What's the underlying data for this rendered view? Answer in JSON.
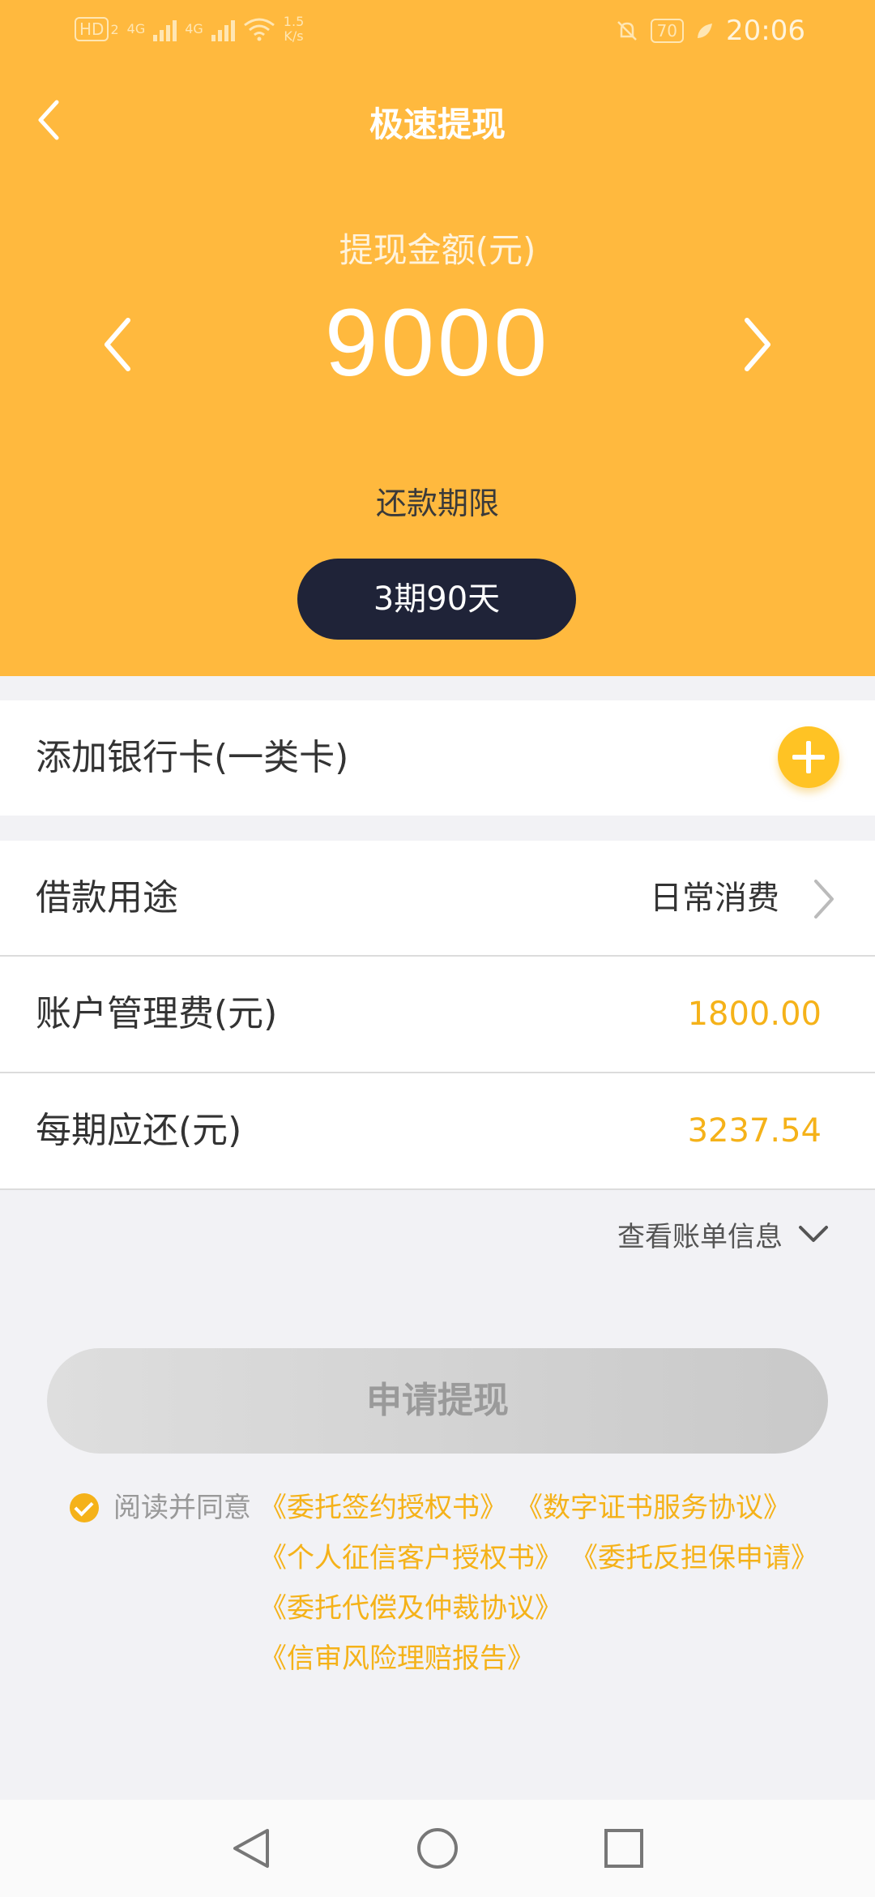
{
  "status_bar": {
    "hd": "HD",
    "sim": "2",
    "net1": "4G",
    "net2": "4G",
    "speed": "1.5",
    "speed_unit": "K/s",
    "battery": "70",
    "time": "20:06"
  },
  "header": {
    "title": "极速提现",
    "back_icon": "chevron-left-icon"
  },
  "amount": {
    "label": "提现金额(元)",
    "value": "9000"
  },
  "term": {
    "label": "还款期限",
    "selected": "3期90天"
  },
  "bank_card": {
    "label": "添加银行卡(一类卡)"
  },
  "details": {
    "purpose_label": "借款用途",
    "purpose_value": "日常消费",
    "fee_label": "账户管理费(元)",
    "fee_value": "1800.00",
    "installment_label": "每期应还(元)",
    "installment_value": "3237.54"
  },
  "bill_link": "查看账单信息",
  "apply_button": "申请提现",
  "agreement": {
    "prefix": "阅读并同意",
    "docs": [
      "《委托签约授权书》",
      "《数字证书服务协议》",
      "《个人征信客户授权书》",
      "《委托反担保申请》",
      "《委托代偿及仲裁协议》",
      "《信审风险理赔报告》"
    ]
  },
  "colors": {
    "primary": "#ffb93e",
    "accent": "#f5b219",
    "dark_button": "#1f2338"
  }
}
